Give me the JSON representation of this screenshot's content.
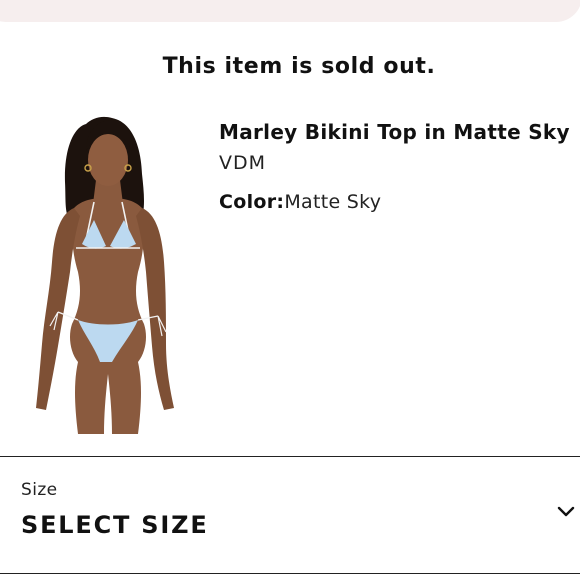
{
  "banner": {
    "message": "This item is sold out."
  },
  "product": {
    "name": "Marley Bikini Top in Matte Sky",
    "brand": "VDM",
    "color_label": "Color:",
    "color_value": "Matte Sky",
    "image_icon": "bikini-product-photo"
  },
  "size_selector": {
    "label": "Size",
    "value": "SELECT SIZE",
    "icon": "chevron-down-icon"
  },
  "colors": {
    "banner_bg": "#f6eeee",
    "bikini": "#bcd9f0",
    "skin": "#8a5a3e",
    "hair": "#1c120d"
  }
}
